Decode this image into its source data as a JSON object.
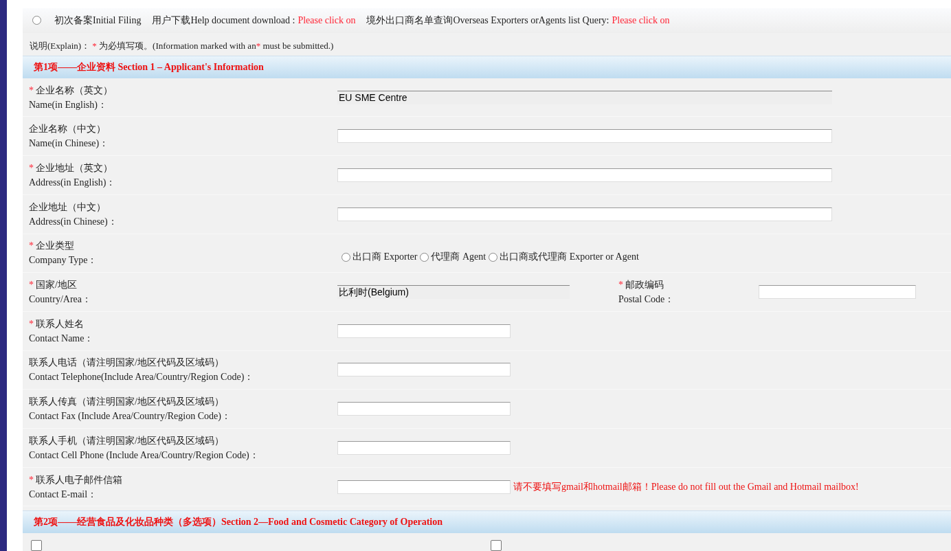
{
  "top_bar": {
    "radio_selected": false,
    "items": [
      {
        "label": "初次备案Initial Filing"
      },
      {
        "label": "用户下载Help document download :",
        "link": "Please click on"
      },
      {
        "label": "境外出口商名单查询Overseas Exporters orAgents list Query:",
        "link": "Please click on"
      }
    ]
  },
  "explain": {
    "label": "说明(Explain)：",
    "mark": "*",
    "text": "为必填写项。(Information marked with an",
    "mark2": "*",
    "text2": "must be submitted.)"
  },
  "section_1": {
    "title": "第1项——企业资料 Section 1 – Applicant's Information"
  },
  "rows": [
    {
      "kind": "text_long",
      "required": true,
      "label_cn": "企业名称（英文）",
      "label_en": "Name(in English)：",
      "value": "EU SME Centre",
      "readonly": true
    },
    {
      "kind": "text_long",
      "required": false,
      "label_cn": "企业名称（中文）",
      "label_en": "Name(in Chinese)：",
      "readonly": false
    },
    {
      "kind": "text_long",
      "required": true,
      "label_cn": "企业地址（英文）",
      "label_en": "Address(in English)：",
      "readonly": false
    },
    {
      "kind": "text_long",
      "required": false,
      "label_cn": "企业地址（中文）",
      "label_en": "Address(in Chinese)：",
      "readonly": false
    },
    {
      "kind": "radio",
      "required": true,
      "label_cn": "企业类型",
      "label_en": "Company Type：",
      "options": [
        {
          "label": "出口商 Exporter",
          "selected": false
        },
        {
          "label": "代理商 Agent",
          "selected": false
        },
        {
          "label": "出口商或代理商 Exporter or Agent",
          "selected": false
        }
      ]
    },
    {
      "kind": "country",
      "required": true,
      "label_cn": "国家/地区",
      "label_en": "Country/Area：",
      "value": "比利时(Belgium)",
      "postal": {
        "required": true,
        "label_cn": "邮政编码",
        "label_en": "Postal Code："
      }
    },
    {
      "kind": "text_short",
      "required": true,
      "label_cn": "联系人姓名",
      "label_en": "Contact Name：",
      "readonly": false
    },
    {
      "kind": "text_short",
      "required": false,
      "label_cn": "联系人电话（请注明国家/地区代码及区域码）",
      "label_en": "Contact Telephone(Include Area/Country/Region Code)：",
      "readonly": false
    },
    {
      "kind": "text_short",
      "required": false,
      "label_cn": "联系人传真（请注明国家/地区代码及区域码）",
      "label_en": "Contact Fax (Include Area/Country/Region Code)：",
      "readonly": false
    },
    {
      "kind": "text_short",
      "required": false,
      "label_cn": "联系人手机（请注明国家/地区代码及区域码）",
      "label_en": "Contact Cell Phone (Include Area/Country/Region Code)：",
      "readonly": false
    },
    {
      "kind": "text_short",
      "required": true,
      "label_cn": "联系人电子邮件信箱",
      "label_en": "Contact E-mail：",
      "readonly": false,
      "note": "请不要填写gmail和hotmail邮箱！Please do not fill out the Gmail and Hotmail mailbox!"
    }
  ],
  "section_2": {
    "title": "第2项——经营食品及化妆品种类（多选项）Section 2—Food and Cosmetic Category of Operation",
    "checkboxes": [
      {
        "checked": false
      },
      {
        "checked": false
      }
    ]
  }
}
